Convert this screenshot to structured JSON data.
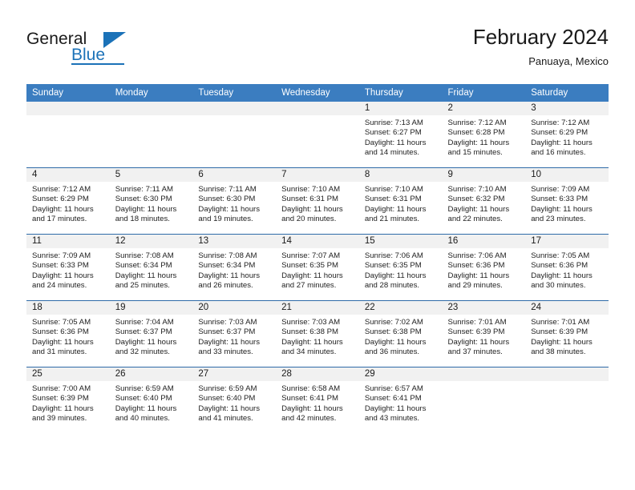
{
  "brand": {
    "name_part1": "General",
    "name_part2": "Blue",
    "accent_color": "#1b72b8"
  },
  "header": {
    "title": "February 2024",
    "location": "Panuaya, Mexico"
  },
  "theme": {
    "header_row_bg": "#3b7dc0",
    "daynum_band_bg": "#f1f1f1",
    "grid_line": "#2f6ba8",
    "text": "#1a1a1a"
  },
  "weekdays": [
    "Sunday",
    "Monday",
    "Tuesday",
    "Wednesday",
    "Thursday",
    "Friday",
    "Saturday"
  ],
  "labels": {
    "sunrise_prefix": "Sunrise:",
    "sunset_prefix": "Sunset:",
    "daylight_prefix": "Daylight:"
  },
  "weeks": [
    [
      {
        "day": "",
        "empty": true
      },
      {
        "day": "",
        "empty": true
      },
      {
        "day": "",
        "empty": true
      },
      {
        "day": "",
        "empty": true
      },
      {
        "day": "1",
        "sunrise": "Sunrise: 7:13 AM",
        "sunset": "Sunset: 6:27 PM",
        "daylight_l1": "Daylight: 11 hours",
        "daylight_l2": "and 14 minutes."
      },
      {
        "day": "2",
        "sunrise": "Sunrise: 7:12 AM",
        "sunset": "Sunset: 6:28 PM",
        "daylight_l1": "Daylight: 11 hours",
        "daylight_l2": "and 15 minutes."
      },
      {
        "day": "3",
        "sunrise": "Sunrise: 7:12 AM",
        "sunset": "Sunset: 6:29 PM",
        "daylight_l1": "Daylight: 11 hours",
        "daylight_l2": "and 16 minutes."
      }
    ],
    [
      {
        "day": "4",
        "sunrise": "Sunrise: 7:12 AM",
        "sunset": "Sunset: 6:29 PM",
        "daylight_l1": "Daylight: 11 hours",
        "daylight_l2": "and 17 minutes."
      },
      {
        "day": "5",
        "sunrise": "Sunrise: 7:11 AM",
        "sunset": "Sunset: 6:30 PM",
        "daylight_l1": "Daylight: 11 hours",
        "daylight_l2": "and 18 minutes."
      },
      {
        "day": "6",
        "sunrise": "Sunrise: 7:11 AM",
        "sunset": "Sunset: 6:30 PM",
        "daylight_l1": "Daylight: 11 hours",
        "daylight_l2": "and 19 minutes."
      },
      {
        "day": "7",
        "sunrise": "Sunrise: 7:10 AM",
        "sunset": "Sunset: 6:31 PM",
        "daylight_l1": "Daylight: 11 hours",
        "daylight_l2": "and 20 minutes."
      },
      {
        "day": "8",
        "sunrise": "Sunrise: 7:10 AM",
        "sunset": "Sunset: 6:31 PM",
        "daylight_l1": "Daylight: 11 hours",
        "daylight_l2": "and 21 minutes."
      },
      {
        "day": "9",
        "sunrise": "Sunrise: 7:10 AM",
        "sunset": "Sunset: 6:32 PM",
        "daylight_l1": "Daylight: 11 hours",
        "daylight_l2": "and 22 minutes."
      },
      {
        "day": "10",
        "sunrise": "Sunrise: 7:09 AM",
        "sunset": "Sunset: 6:33 PM",
        "daylight_l1": "Daylight: 11 hours",
        "daylight_l2": "and 23 minutes."
      }
    ],
    [
      {
        "day": "11",
        "sunrise": "Sunrise: 7:09 AM",
        "sunset": "Sunset: 6:33 PM",
        "daylight_l1": "Daylight: 11 hours",
        "daylight_l2": "and 24 minutes."
      },
      {
        "day": "12",
        "sunrise": "Sunrise: 7:08 AM",
        "sunset": "Sunset: 6:34 PM",
        "daylight_l1": "Daylight: 11 hours",
        "daylight_l2": "and 25 minutes."
      },
      {
        "day": "13",
        "sunrise": "Sunrise: 7:08 AM",
        "sunset": "Sunset: 6:34 PM",
        "daylight_l1": "Daylight: 11 hours",
        "daylight_l2": "and 26 minutes."
      },
      {
        "day": "14",
        "sunrise": "Sunrise: 7:07 AM",
        "sunset": "Sunset: 6:35 PM",
        "daylight_l1": "Daylight: 11 hours",
        "daylight_l2": "and 27 minutes."
      },
      {
        "day": "15",
        "sunrise": "Sunrise: 7:06 AM",
        "sunset": "Sunset: 6:35 PM",
        "daylight_l1": "Daylight: 11 hours",
        "daylight_l2": "and 28 minutes."
      },
      {
        "day": "16",
        "sunrise": "Sunrise: 7:06 AM",
        "sunset": "Sunset: 6:36 PM",
        "daylight_l1": "Daylight: 11 hours",
        "daylight_l2": "and 29 minutes."
      },
      {
        "day": "17",
        "sunrise": "Sunrise: 7:05 AM",
        "sunset": "Sunset: 6:36 PM",
        "daylight_l1": "Daylight: 11 hours",
        "daylight_l2": "and 30 minutes."
      }
    ],
    [
      {
        "day": "18",
        "sunrise": "Sunrise: 7:05 AM",
        "sunset": "Sunset: 6:36 PM",
        "daylight_l1": "Daylight: 11 hours",
        "daylight_l2": "and 31 minutes."
      },
      {
        "day": "19",
        "sunrise": "Sunrise: 7:04 AM",
        "sunset": "Sunset: 6:37 PM",
        "daylight_l1": "Daylight: 11 hours",
        "daylight_l2": "and 32 minutes."
      },
      {
        "day": "20",
        "sunrise": "Sunrise: 7:03 AM",
        "sunset": "Sunset: 6:37 PM",
        "daylight_l1": "Daylight: 11 hours",
        "daylight_l2": "and 33 minutes."
      },
      {
        "day": "21",
        "sunrise": "Sunrise: 7:03 AM",
        "sunset": "Sunset: 6:38 PM",
        "daylight_l1": "Daylight: 11 hours",
        "daylight_l2": "and 34 minutes."
      },
      {
        "day": "22",
        "sunrise": "Sunrise: 7:02 AM",
        "sunset": "Sunset: 6:38 PM",
        "daylight_l1": "Daylight: 11 hours",
        "daylight_l2": "and 36 minutes."
      },
      {
        "day": "23",
        "sunrise": "Sunrise: 7:01 AM",
        "sunset": "Sunset: 6:39 PM",
        "daylight_l1": "Daylight: 11 hours",
        "daylight_l2": "and 37 minutes."
      },
      {
        "day": "24",
        "sunrise": "Sunrise: 7:01 AM",
        "sunset": "Sunset: 6:39 PM",
        "daylight_l1": "Daylight: 11 hours",
        "daylight_l2": "and 38 minutes."
      }
    ],
    [
      {
        "day": "25",
        "sunrise": "Sunrise: 7:00 AM",
        "sunset": "Sunset: 6:39 PM",
        "daylight_l1": "Daylight: 11 hours",
        "daylight_l2": "and 39 minutes."
      },
      {
        "day": "26",
        "sunrise": "Sunrise: 6:59 AM",
        "sunset": "Sunset: 6:40 PM",
        "daylight_l1": "Daylight: 11 hours",
        "daylight_l2": "and 40 minutes."
      },
      {
        "day": "27",
        "sunrise": "Sunrise: 6:59 AM",
        "sunset": "Sunset: 6:40 PM",
        "daylight_l1": "Daylight: 11 hours",
        "daylight_l2": "and 41 minutes."
      },
      {
        "day": "28",
        "sunrise": "Sunrise: 6:58 AM",
        "sunset": "Sunset: 6:41 PM",
        "daylight_l1": "Daylight: 11 hours",
        "daylight_l2": "and 42 minutes."
      },
      {
        "day": "29",
        "sunrise": "Sunrise: 6:57 AM",
        "sunset": "Sunset: 6:41 PM",
        "daylight_l1": "Daylight: 11 hours",
        "daylight_l2": "and 43 minutes."
      },
      {
        "day": "",
        "empty": true
      },
      {
        "day": "",
        "empty": true
      }
    ]
  ]
}
